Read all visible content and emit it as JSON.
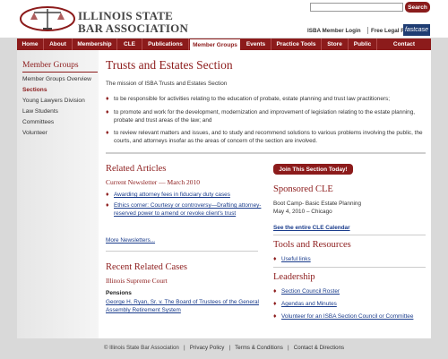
{
  "header": {
    "logo_line1": "ILLINOIS STATE",
    "logo_line2": "BAR ASSOCIATION",
    "search_button": "Search",
    "search_placeholder": "",
    "member_login": "ISBA Member Login",
    "free_research": "Free Legal Research",
    "fastcase": "fastcase"
  },
  "nav": {
    "items": [
      "Home",
      "About",
      "Membership",
      "CLE",
      "Publications",
      "Member Groups",
      "Events",
      "Practice Tools",
      "Store",
      "Public",
      "Contact"
    ],
    "active": "Member Groups"
  },
  "sidebar": {
    "title": "Member Groups",
    "items": [
      "Member Groups Overview",
      "Sections",
      "Young Lawyers Division",
      "Law Students",
      "Committees",
      "Volunteer"
    ],
    "active": "Sections"
  },
  "main": {
    "title": "Trusts and Estates Section",
    "mission": "The mission of ISBA Trusts and Estates Section",
    "bullets": [
      "to be responsible for activities relating to the education of probate, estate planning and trust law practitioners;",
      "to promote and work for the development, modernization and improvement of legislation relating to the estate planning, probate and trust areas of the law; and",
      "to review relevant matters and issues, and to study and recommend solutions to various problems involving the public, the courts, and attorneys insofar as the areas of concern of the section are involved."
    ]
  },
  "articles": {
    "heading": "Related Articles",
    "newsletter": "Current Newsletter — March 2010",
    "items": [
      "Awarding attorney fees in fiduciary duty cases",
      "Ethics corner: Courtesy or controversy—Drafting attorney-reserved power to amend or revoke client's trust"
    ],
    "more": "More Newsletters..."
  },
  "cases": {
    "heading": "Recent Related Cases",
    "court": "Illinois Supreme Court",
    "category": "Pensions",
    "case_link": "George H. Ryan, Sr. v. The Board of Trustees of the General Assembly Retirement System"
  },
  "right": {
    "join_button": "Join This Section Today!",
    "cle_heading": "Sponsored CLE",
    "cle_event": "Boot Camp- Basic Estate Planning",
    "cle_date": "May 4, 2010 – Chicago",
    "cle_calendar": "See the entire CLE Calendar",
    "tools_heading": "Tools and Resources",
    "tools_items": [
      "Useful links"
    ],
    "leadership_heading": "Leadership",
    "leadership_items": [
      "Section Council Roster",
      "Agendas and Minutes",
      "Volunteer for an ISBA Section Council or Committee"
    ]
  },
  "footer": {
    "copyright": "© Illinois State Bar Association",
    "links": [
      "Privacy Policy",
      "Terms & Conditions",
      "Contact & Directions"
    ],
    "separator": "|"
  },
  "colors": {
    "brand_red": "#8c1b1b",
    "link_blue": "#1a3c8c",
    "background_gray": "#d9d9d9"
  }
}
